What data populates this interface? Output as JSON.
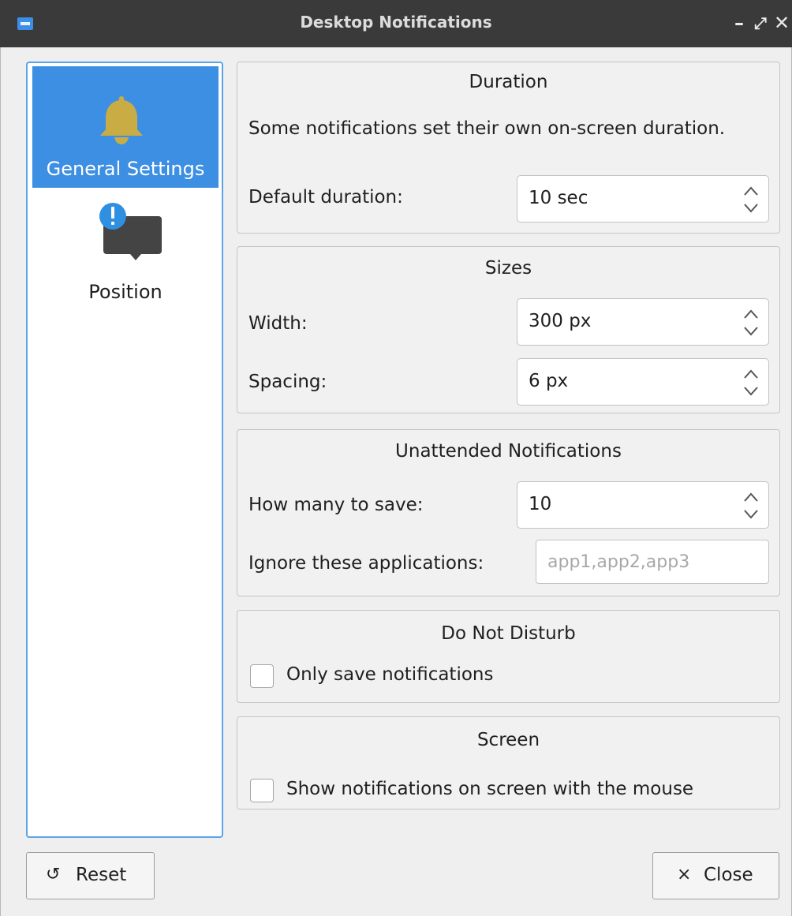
{
  "window": {
    "title": "Desktop Notifications",
    "controls": {
      "minimize": "–",
      "maximize": "⤢",
      "close": "✕"
    },
    "accent": "#3c8fe3"
  },
  "sidebar": {
    "items": [
      {
        "label": "General Settings",
        "icon": "bell-icon",
        "selected": true
      },
      {
        "label": "Position",
        "icon": "notification-bubble-icon",
        "selected": false
      }
    ]
  },
  "duration": {
    "title": "Duration",
    "description": "Some notifications set their own on-screen duration.",
    "default_label": "Default duration:",
    "default_value": "10 sec"
  },
  "sizes": {
    "title": "Sizes",
    "width_label": "Width:",
    "width_value": "300 px",
    "spacing_label": "Spacing:",
    "spacing_value": "6 px"
  },
  "unattended": {
    "title": "Unattended Notifications",
    "save_label": "How many to save:",
    "save_value": "10",
    "ignore_label": "Ignore these applications:",
    "ignore_value": "",
    "ignore_placeholder": "app1,app2,app3"
  },
  "dnd": {
    "title": "Do Not Disturb",
    "only_save_label": "Only save notifications",
    "only_save_checked": false
  },
  "screen": {
    "title": "Screen",
    "mouse_label": "Show notifications on screen with the mouse",
    "mouse_checked": false
  },
  "buttons": {
    "reset_icon": "↺",
    "reset_label": "Reset",
    "close_icon": "×",
    "close_label": "Close"
  }
}
